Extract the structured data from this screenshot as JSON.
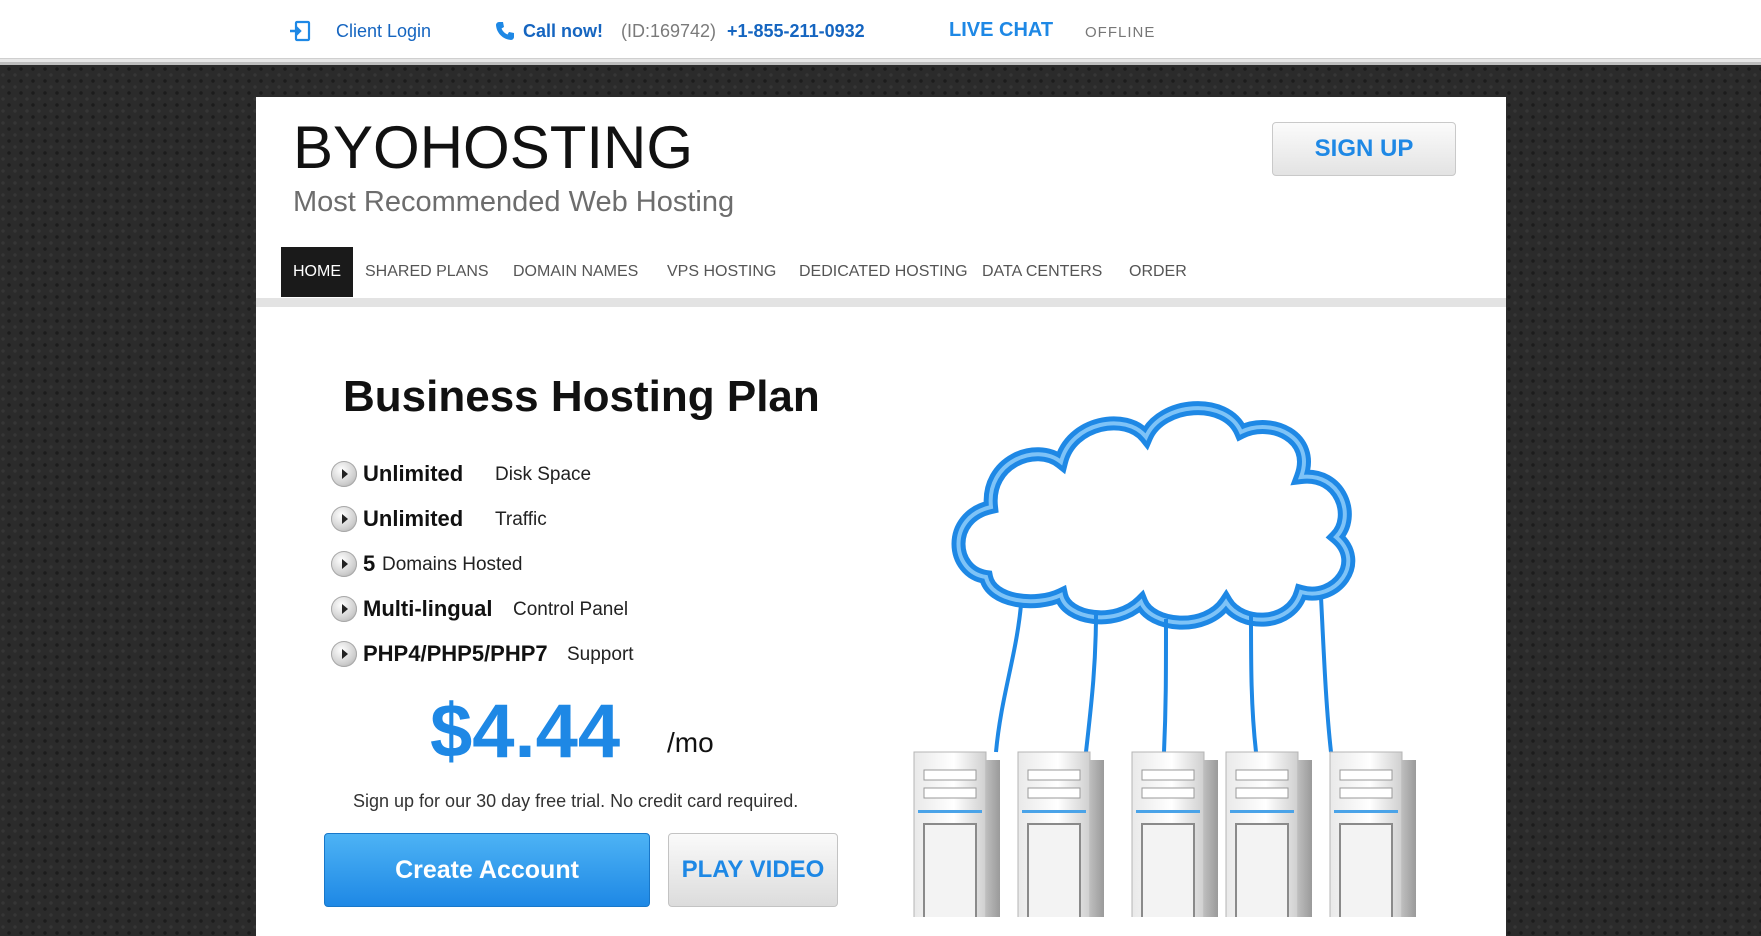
{
  "topbar": {
    "client_login": "Client Login",
    "call_now": "Call now!",
    "call_id": "(ID:169742)",
    "phone": "+1-855-211-0932",
    "live_chat": "LIVE CHAT",
    "chat_status": "OFFLINE"
  },
  "header": {
    "brand": "BYOHOSTING",
    "tagline": "Most Recommended Web Hosting",
    "signup_label": "SIGN UP"
  },
  "nav": {
    "items": [
      {
        "label": "HOME",
        "active": true
      },
      {
        "label": "SHARED PLANS"
      },
      {
        "label": "DOMAIN NAMES"
      },
      {
        "label": "VPS HOSTING"
      },
      {
        "label": "DEDICATED HOSTING"
      },
      {
        "label": "DATA CENTERS"
      },
      {
        "label": "ORDER"
      }
    ]
  },
  "hero": {
    "title": "Business Hosting Plan",
    "features": [
      {
        "strong": "Unlimited",
        "rest": "Disk Space"
      },
      {
        "strong": "Unlimited",
        "rest": "Traffic"
      },
      {
        "strong": "5",
        "rest": "Domains Hosted"
      },
      {
        "strong": "Multi-lingual",
        "rest": "Control Panel"
      },
      {
        "strong": "PHP4/PHP5/PHP7",
        "rest": "Support"
      }
    ],
    "price": "$4.44",
    "per": "/mo",
    "trial_text": "Sign up for our 30 day free trial. No credit card required.",
    "create_label": "Create Account",
    "video_label": "PLAY VIDEO"
  },
  "colors": {
    "accent": "#1e88e5",
    "link": "#1565c0",
    "nav_active_bg": "#1a1a1a"
  },
  "icons": {
    "login": "login-icon",
    "phone": "phone-icon",
    "bullet": "play-bullet-icon",
    "illustration": "cloud-servers-illustration"
  }
}
